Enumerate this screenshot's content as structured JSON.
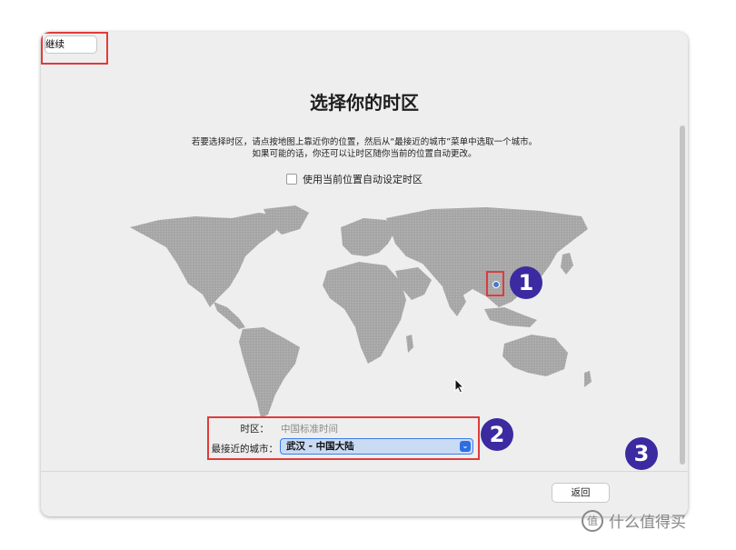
{
  "window": {
    "title": "选择你的时区",
    "description_line1": "若要选择时区，请点按地图上靠近你的位置，然后从“最接近的城市”菜单中选取一个城市。",
    "description_line2": "如果可能的话，你还可以让时区随你当前的位置自动更改。",
    "auto_timezone_label": "使用当前位置自动设定时区",
    "auto_timezone_checked": false
  },
  "timezone": {
    "label": "时区：",
    "value": "中国标准时间"
  },
  "closest_city": {
    "label": "最接近的城市：",
    "value": "武汉 - 中国大陆"
  },
  "buttons": {
    "back": "返回",
    "continue": "继续"
  },
  "annotations": {
    "badge1": "1",
    "badge2": "2",
    "badge3": "3"
  },
  "watermark": {
    "icon": "值",
    "text": "什么值得买"
  },
  "colors": {
    "annotation_box": "#e03b3b",
    "badge": "#3b2aa0",
    "select_accent": "#2e6ee4"
  }
}
